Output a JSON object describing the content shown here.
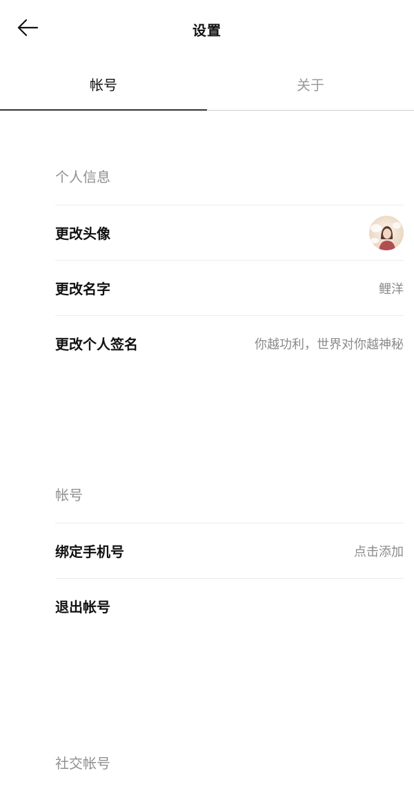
{
  "header": {
    "title": "设置",
    "back_icon": "arrow-left-icon"
  },
  "tabs": [
    {
      "label": "帐号",
      "active": true
    },
    {
      "label": "关于",
      "active": false
    }
  ],
  "sections": {
    "personal": {
      "title": "个人信息",
      "rows": {
        "avatar": {
          "label": "更改头像",
          "value_icon": "avatar-image"
        },
        "name": {
          "label": "更改名字",
          "value": "鲤洋"
        },
        "signature": {
          "label": "更改个人签名",
          "value": "你越功利，世界对你越神秘"
        }
      }
    },
    "account": {
      "title": "帐号",
      "rows": {
        "phone": {
          "label": "绑定手机号",
          "value": "点击添加"
        },
        "logout": {
          "label": "退出帐号"
        }
      }
    },
    "social": {
      "title": "社交帐号"
    }
  },
  "colors": {
    "text_primary": "#111111",
    "text_secondary": "#8a8a8a",
    "divider": "#ececec",
    "tab_indicator": "#333333"
  }
}
